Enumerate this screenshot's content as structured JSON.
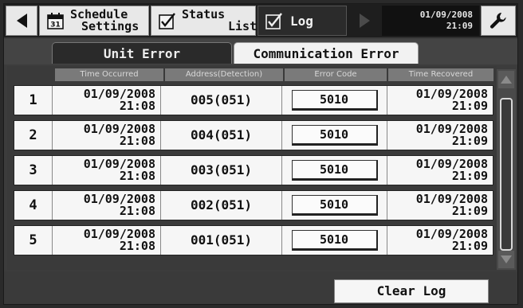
{
  "topbar": {
    "back_icon": "triangle-left-icon",
    "tabs": [
      {
        "line1": "Schedule",
        "line2": "Settings",
        "icon": "calendar-icon"
      },
      {
        "line1": "Status",
        "line2": "List",
        "icon": "checkbox-icon"
      },
      {
        "label": "Log",
        "icon": "checkbox-icon"
      }
    ],
    "forward_icon": "triangle-right-icon",
    "clock": {
      "date": "01/09/2008",
      "time": "21:09"
    },
    "settings_icon": "wrench-icon"
  },
  "subtabs": [
    "Unit Error",
    "Communication Error"
  ],
  "table": {
    "columns": [
      "Time Occurred",
      "Address(Detection)",
      "Error Code",
      "Time Recovered"
    ],
    "rows": [
      {
        "num": "1",
        "occ_date": "01/09/2008",
        "occ_time": "21:08",
        "address": "005(051)",
        "code": "5010",
        "rec_date": "01/09/2008",
        "rec_time": "21:09"
      },
      {
        "num": "2",
        "occ_date": "01/09/2008",
        "occ_time": "21:08",
        "address": "004(051)",
        "code": "5010",
        "rec_date": "01/09/2008",
        "rec_time": "21:09"
      },
      {
        "num": "3",
        "occ_date": "01/09/2008",
        "occ_time": "21:08",
        "address": "003(051)",
        "code": "5010",
        "rec_date": "01/09/2008",
        "rec_time": "21:09"
      },
      {
        "num": "4",
        "occ_date": "01/09/2008",
        "occ_time": "21:08",
        "address": "002(051)",
        "code": "5010",
        "rec_date": "01/09/2008",
        "rec_time": "21:09"
      },
      {
        "num": "5",
        "occ_date": "01/09/2008",
        "occ_time": "21:08",
        "address": "001(051)",
        "code": "5010",
        "rec_date": "01/09/2008",
        "rec_time": "21:09"
      }
    ]
  },
  "scrollbar": {
    "up_icon": "scroll-up-icon",
    "down_icon": "scroll-down-icon"
  },
  "footer": {
    "clear_label": "Clear Log"
  }
}
